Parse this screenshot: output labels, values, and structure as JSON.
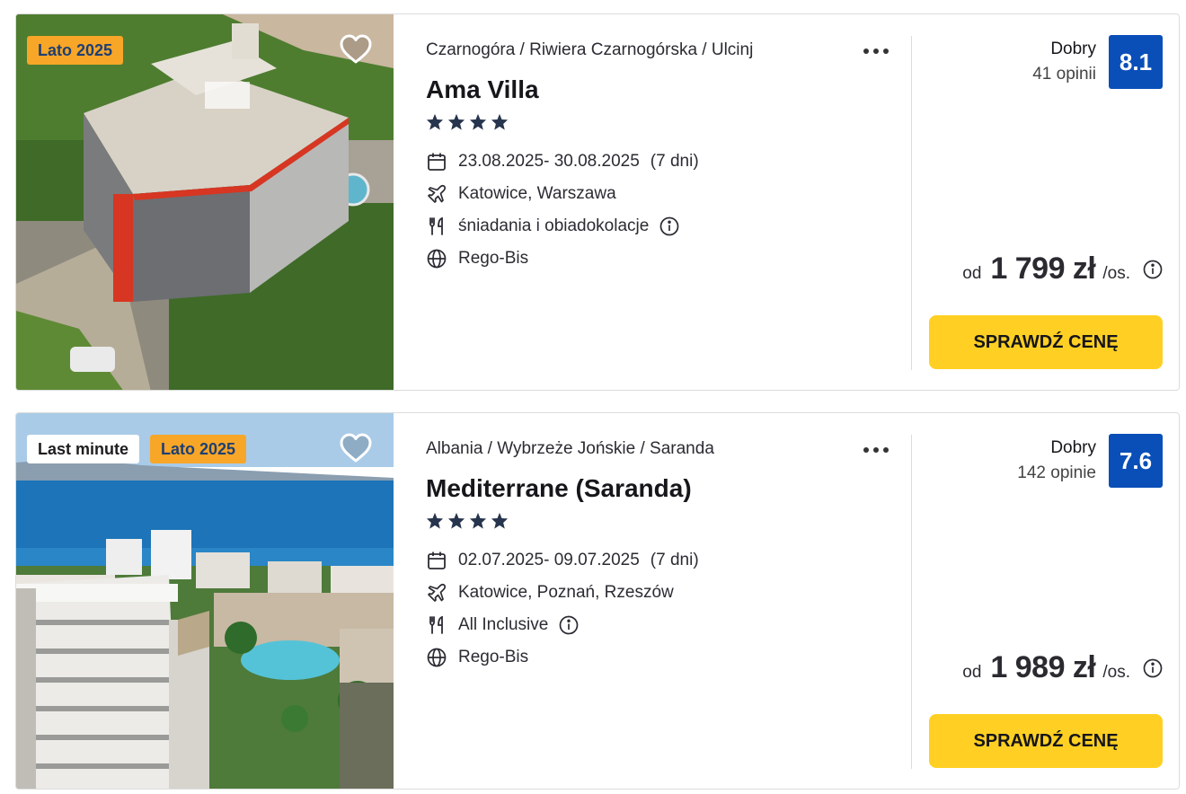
{
  "colors": {
    "badge_orange": "#f7a628",
    "rating_blue": "#0a4fb8",
    "cta_yellow": "#ffd023",
    "star_navy": "#27344d"
  },
  "offers": [
    {
      "badges": [
        "Lato 2025"
      ],
      "breadcrumb": "Czarnogóra / Riwiera Czarnogórska / Ulcinj",
      "name": "Ama Villa",
      "stars": 4,
      "dates": "23.08.2025- 30.08.2025",
      "duration": "(7 dni)",
      "departure": "Katowice, Warszawa",
      "board": "śniadania i obiadokolacje",
      "operator": "Rego-Bis",
      "rating_label": "Dobry",
      "rating_count": "41 opinii",
      "rating_score": "8.1",
      "price_from": "od",
      "price": "1 799 zł",
      "price_unit": "/os.",
      "cta": "SPRAWDŹ CENĘ"
    },
    {
      "badges": [
        "Last minute",
        "Lato 2025"
      ],
      "breadcrumb": "Albania / Wybrzeże Jońskie / Saranda",
      "name": "Mediterrane (Saranda)",
      "stars": 4,
      "dates": "02.07.2025- 09.07.2025",
      "duration": "(7 dni)",
      "departure": "Katowice, Poznań, Rzeszów",
      "board": "All Inclusive",
      "operator": "Rego-Bis",
      "rating_label": "Dobry",
      "rating_count": "142 opinie",
      "rating_score": "7.6",
      "price_from": "od",
      "price": "1 989 zł",
      "price_unit": "/os.",
      "cta": "SPRAWDŹ CENĘ"
    }
  ],
  "icons": {
    "favorite": "heart-icon",
    "more": "more-dots-icon",
    "star": "star-icon",
    "date": "calendar-icon",
    "departure": "plane-icon",
    "board": "cutlery-icon",
    "operator": "globe-icon",
    "info": "info-icon"
  }
}
